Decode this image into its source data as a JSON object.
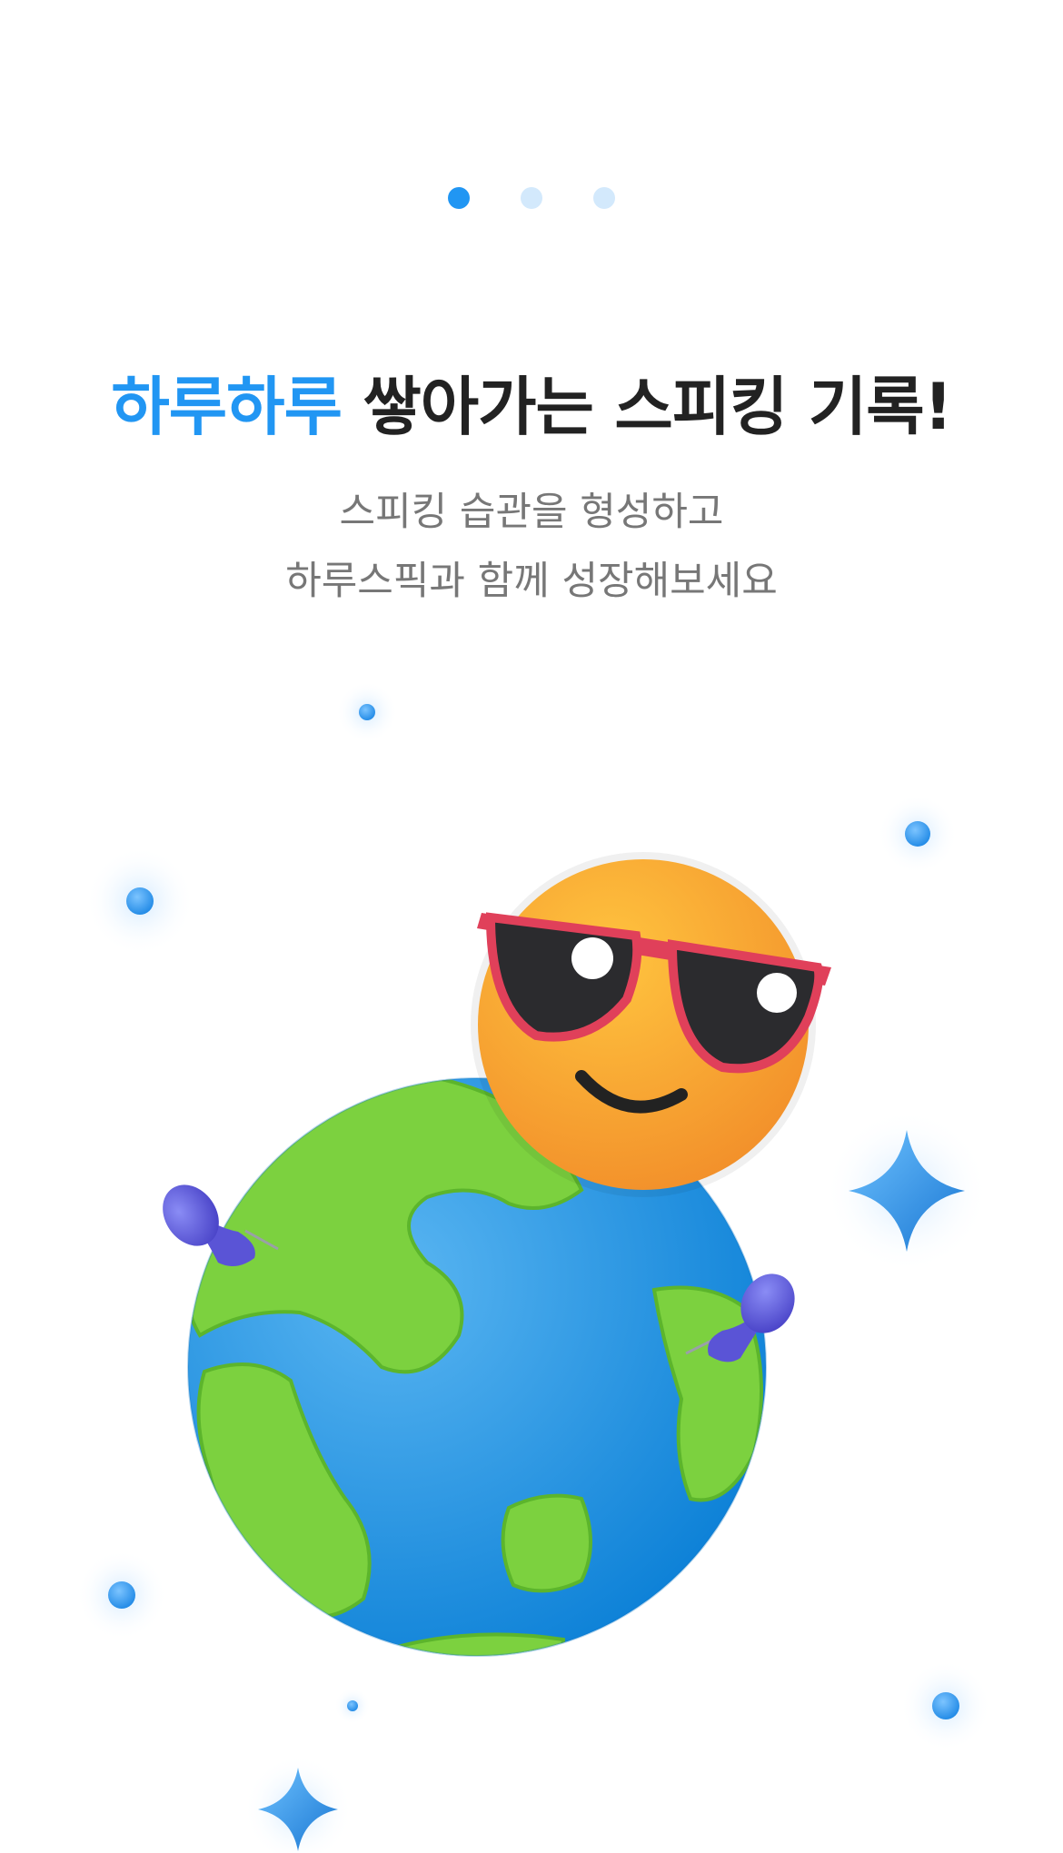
{
  "onboarding": {
    "pager": {
      "count": 3,
      "active_index": 0,
      "active_color": "#2196f3",
      "inactive_color": "#d3e9fc"
    },
    "headline": {
      "highlight": "하루하루",
      "rest": " 쌓아가는 스피킹 기록!",
      "highlight_color": "#2196f3"
    },
    "subtitle": {
      "line1": "스피킹 습관을 형성하고",
      "line2": "하루스픽과 함께 성장해보세요"
    },
    "illustration": {
      "icons": [
        "globe-icon",
        "sunglasses-emoji-icon",
        "push-pin-icon",
        "sparkle-icon"
      ]
    }
  }
}
